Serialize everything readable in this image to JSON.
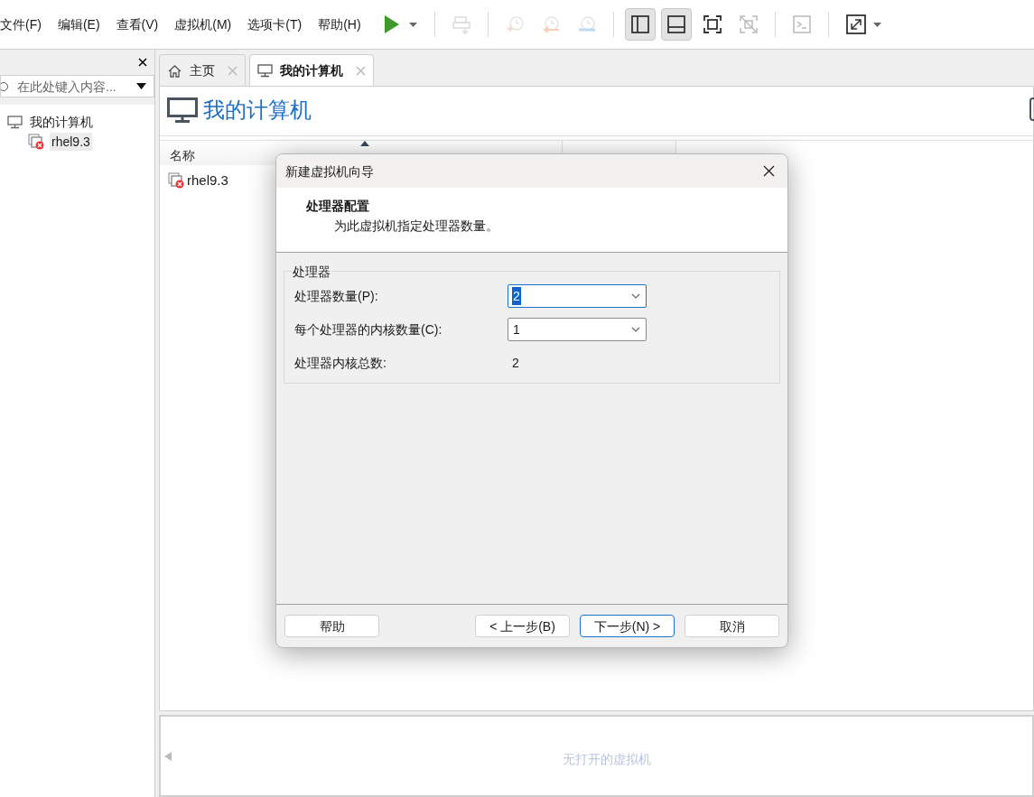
{
  "menu": [
    "文件(F)",
    "编辑(E)",
    "查看(V)",
    "虚拟机(M)",
    "选项卡(T)",
    "帮助(H)"
  ],
  "toolbar": [
    {
      "kind": "play",
      "disabled": false,
      "pressed": false
    },
    {
      "kind": "sep"
    },
    {
      "kind": "send",
      "disabled": true,
      "pressed": false
    },
    {
      "kind": "sep"
    },
    {
      "kind": "snap-take",
      "disabled": true,
      "pressed": false
    },
    {
      "kind": "snap-revert",
      "disabled": true,
      "pressed": false
    },
    {
      "kind": "snap-manage",
      "disabled": true,
      "pressed": false
    },
    {
      "kind": "sep"
    },
    {
      "kind": "view-library",
      "disabled": false,
      "pressed": true
    },
    {
      "kind": "view-thumbs",
      "disabled": false,
      "pressed": true
    },
    {
      "kind": "view-full",
      "disabled": false,
      "pressed": false
    },
    {
      "kind": "view-unity",
      "disabled": true,
      "pressed": false
    },
    {
      "kind": "sep"
    },
    {
      "kind": "console",
      "disabled": true,
      "pressed": false
    },
    {
      "kind": "sep"
    },
    {
      "kind": "stretch",
      "disabled": false,
      "pressed": false
    }
  ],
  "sidebar": {
    "search": {
      "placeholder": "在此处键入内容..."
    },
    "tree": [
      {
        "label": "我的计算机",
        "kind": "computer",
        "selected": false,
        "children": [
          {
            "label": "rhel9.3",
            "kind": "vm",
            "selected": true
          }
        ]
      }
    ]
  },
  "tabs": [
    {
      "label": "主页",
      "kind": "home",
      "selected": false
    },
    {
      "label": "我的计算机",
      "kind": "computer",
      "selected": true
    }
  ],
  "page": {
    "title": "我的计算机",
    "columns": [
      "名称"
    ],
    "rows": [
      "rhel9.3"
    ]
  },
  "bottom_panel": {
    "message": "无打开的虚拟机"
  },
  "dialog": {
    "title": "新建虚拟机向导",
    "heading": "处理器配置",
    "subheading": "为此虚拟机指定处理器数量。",
    "group": "处理器",
    "fields": [
      {
        "label": "处理器数量(P):",
        "kind": "dropdown",
        "value": "2",
        "focused": true
      },
      {
        "label": "每个处理器的内核数量(C):",
        "kind": "dropdown",
        "value": "1",
        "focused": false
      },
      {
        "label": "处理器内核总数:",
        "kind": "text",
        "value": "2"
      }
    ],
    "buttons": [
      {
        "label": "帮助",
        "default": false
      },
      {
        "label": "< 上一步(B)",
        "default": false
      },
      {
        "label": "下一步(N) >",
        "default": true
      },
      {
        "label": "取消",
        "default": false
      }
    ]
  }
}
